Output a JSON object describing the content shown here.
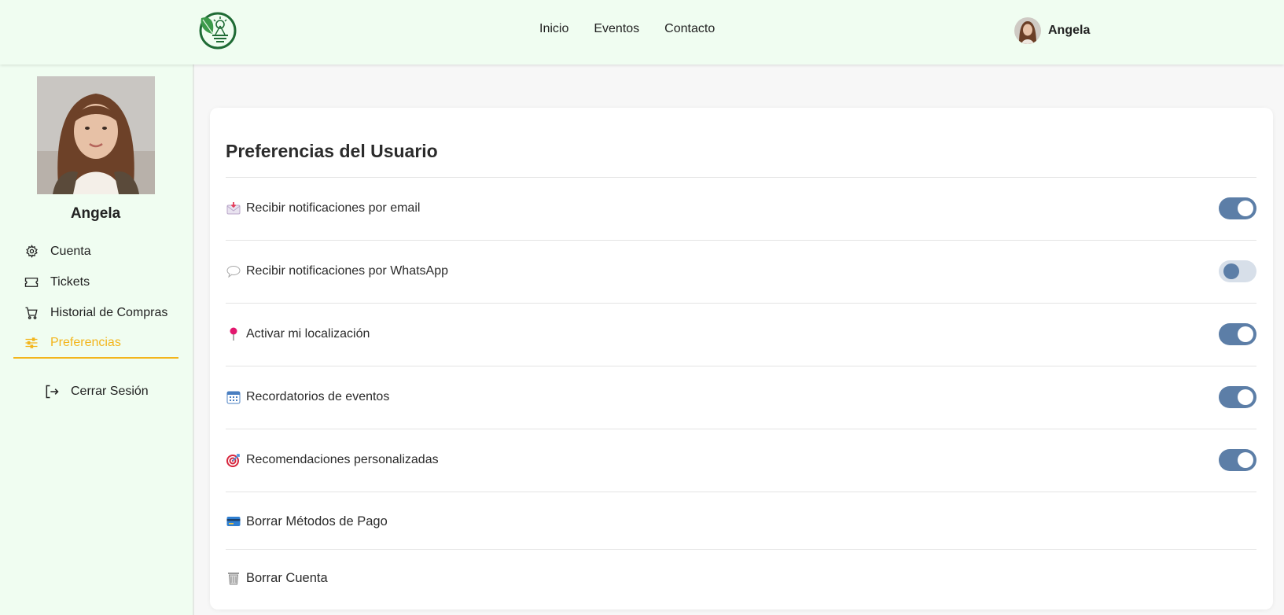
{
  "header": {
    "logo_icon": "leaf-sun-logo",
    "nav": [
      "Inicio",
      "Eventos",
      "Contacto"
    ],
    "user_name": "Angela"
  },
  "sidebar": {
    "profile_name": "Angela",
    "items": [
      {
        "label": "Cuenta",
        "icon": "gear-icon",
        "active": false
      },
      {
        "label": "Tickets",
        "icon": "ticket-icon",
        "active": false
      },
      {
        "label": "Historial de Compras",
        "icon": "cart-icon",
        "active": false
      },
      {
        "label": "Preferencias",
        "icon": "sliders-icon",
        "active": true
      }
    ],
    "logout_label": "Cerrar Sesión",
    "accent_color": "#f3b51c"
  },
  "main": {
    "title": "Preferencias del Usuario",
    "preferences": [
      {
        "label": "Recibir notificaciones por email",
        "icon": "envelope-icon",
        "enabled": true
      },
      {
        "label": "Recibir notificaciones por WhatsApp",
        "icon": "speech-bubble-icon",
        "enabled": false
      },
      {
        "label": "Activar mi localización",
        "icon": "pushpin-icon",
        "enabled": true
      },
      {
        "label": "Recordatorios de eventos",
        "icon": "calendar-icon",
        "enabled": true
      },
      {
        "label": "Recomendaciones personalizadas",
        "icon": "target-icon",
        "enabled": true
      }
    ],
    "actions": [
      {
        "label": "Borrar Métodos de Pago",
        "icon": "credit-card-icon"
      },
      {
        "label": "Borrar Cuenta",
        "icon": "trash-can-icon"
      }
    ],
    "toggle_on_color": "#5c7ea7"
  }
}
